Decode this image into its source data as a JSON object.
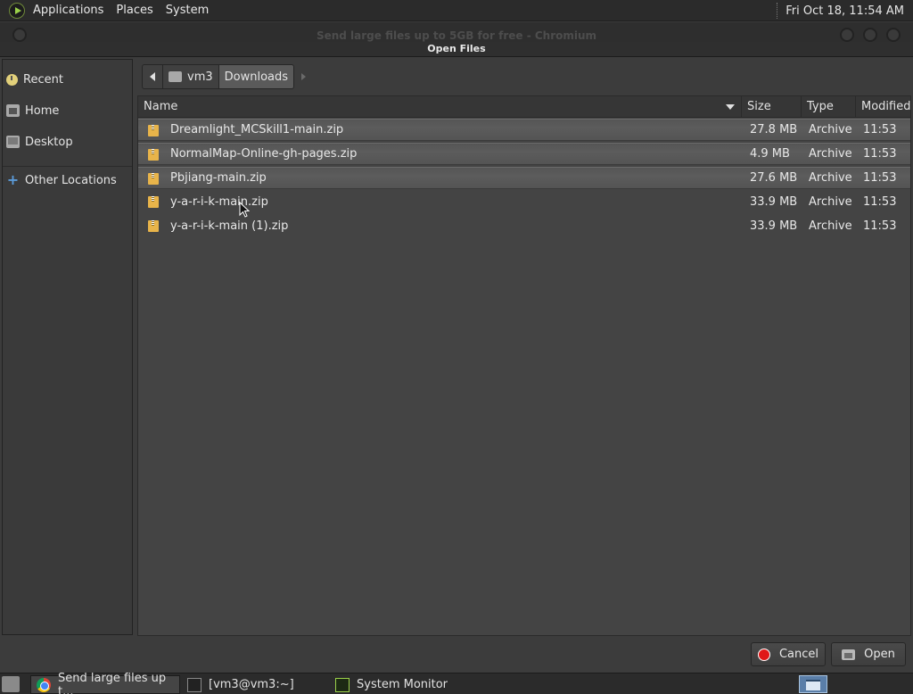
{
  "top_panel": {
    "menus": [
      "Applications",
      "Places",
      "System"
    ],
    "clock": "Fri Oct 18, 11:54 AM"
  },
  "window": {
    "title": "Send large files up to 5GB for free - Chromium"
  },
  "dialog": {
    "title": "Open Files"
  },
  "sidebar": {
    "items": [
      {
        "label": "Recent",
        "icon": "clock-icon"
      },
      {
        "label": "Home",
        "icon": "home-folder-icon"
      },
      {
        "label": "Desktop",
        "icon": "desktop-icon"
      },
      {
        "label": "Other Locations",
        "icon": "plus-icon"
      }
    ]
  },
  "pathbar": {
    "segments": [
      "vm3",
      "Downloads"
    ]
  },
  "file_list": {
    "columns": [
      "Name",
      "Size",
      "Type",
      "Modified"
    ],
    "rows": [
      {
        "name": "Dreamlight_MCSkill1-main.zip",
        "size": "27.8 MB",
        "type": "Archive",
        "modified": "11:53",
        "selected": true
      },
      {
        "name": "NormalMap-Online-gh-pages.zip",
        "size": "4.9 MB",
        "type": "Archive",
        "modified": "11:53",
        "selected": true
      },
      {
        "name": "Pbjiang-main.zip",
        "size": "27.6 MB",
        "type": "Archive",
        "modified": "11:53",
        "selected": true
      },
      {
        "name": "y-a-r-i-k-main.zip",
        "size": "33.9 MB",
        "type": "Archive",
        "modified": "11:53",
        "selected": false
      },
      {
        "name": "y-a-r-i-k-main (1).zip",
        "size": "33.9 MB",
        "type": "Archive",
        "modified": "11:53",
        "selected": false
      }
    ]
  },
  "buttons": {
    "cancel": "Cancel",
    "open": "Open"
  },
  "taskbar": {
    "tasks": [
      {
        "label": "Send large files up t...",
        "icon": "chromium-icon"
      },
      {
        "label": "[vm3@vm3:~]",
        "icon": "terminal-icon"
      },
      {
        "label": "System Monitor",
        "icon": "system-monitor-icon"
      }
    ]
  },
  "colors": {
    "panel_bg": "#2b2b2b",
    "dialog_bg": "#3c3c3c",
    "list_bg": "#444444",
    "selection": "#585858",
    "file_icon": "#e8b44a",
    "cancel_red": "#e01818"
  }
}
